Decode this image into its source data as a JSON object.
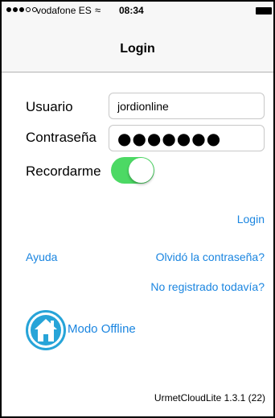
{
  "status": {
    "carrier": "vodafone ES",
    "wifi_glyph": "≈",
    "time": "08:34"
  },
  "nav": {
    "title": "Login"
  },
  "form": {
    "username_label": "Usuario",
    "username_value": "jordionline",
    "password_label": "Contraseña",
    "password_value": "●●●●●●●",
    "remember_label": "Recordarme",
    "remember_on": true
  },
  "links": {
    "login": "Login",
    "help": "Ayuda",
    "forgot": "Olvidó la contraseña?",
    "register": "No registrado todavía?",
    "offline": "Modo Offline"
  },
  "footer": {
    "version": "UrmetCloudLite 1.3.1 (22)"
  },
  "colors": {
    "link": "#1a85e0",
    "toggle_on": "#4cd964",
    "offline_icon": "#27a4d8"
  },
  "icons": {
    "offline": "home-icon",
    "wifi": "wifi-icon",
    "battery": "battery-icon"
  }
}
